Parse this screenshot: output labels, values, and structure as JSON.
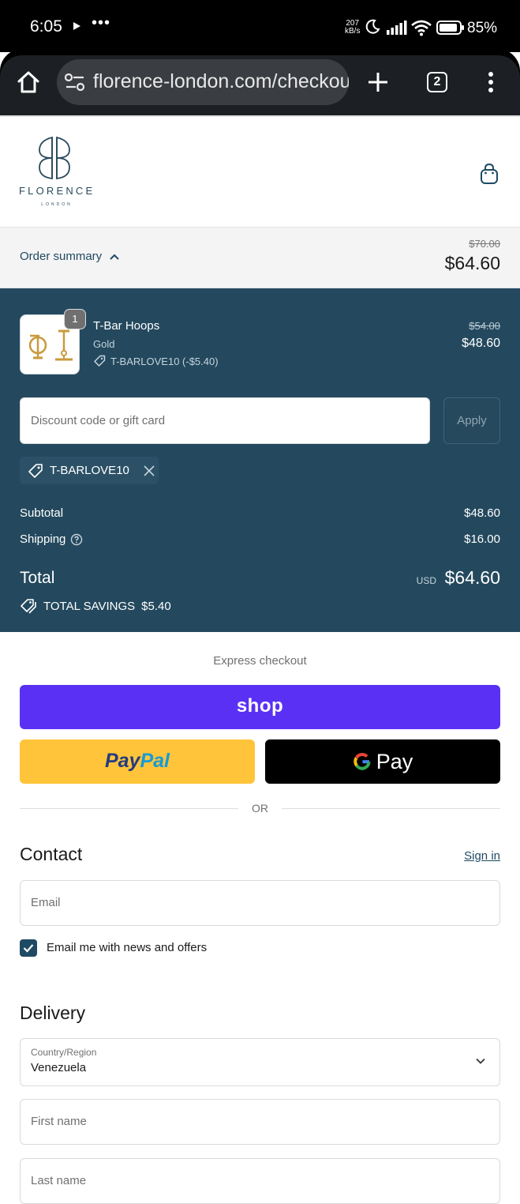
{
  "status_bar": {
    "time": "6:05",
    "overflow": "•••",
    "speed_value": "207",
    "speed_unit": "kB/s",
    "battery": "85%"
  },
  "browser": {
    "url": "florence-london.com/checkout",
    "tab_count": "2"
  },
  "brand": {
    "name": "FLORENCE",
    "sub": "LONDON"
  },
  "summary": {
    "toggle_label": "Order summary",
    "original_total": "$70.00",
    "total": "$64.60"
  },
  "product": {
    "quantity": "1",
    "name": "T-Bar Hoops",
    "variant": "Gold",
    "discount_line": "T-BARLOVE10 (-$5.40)",
    "original_price": "$54.00",
    "price": "$48.60"
  },
  "discount": {
    "placeholder": "Discount code or gift card",
    "apply_label": "Apply",
    "applied_code": "T-BARLOVE10"
  },
  "totals": {
    "subtotal_label": "Subtotal",
    "subtotal_value": "$48.60",
    "shipping_label": "Shipping",
    "shipping_value": "$16.00",
    "total_label": "Total",
    "currency": "USD",
    "total_value": "$64.60",
    "savings_label": "TOTAL SAVINGS",
    "savings_value": "$5.40"
  },
  "express": {
    "title": "Express checkout",
    "shop_label": "shop",
    "paypal_a": "Pay",
    "paypal_b": "Pal",
    "gpay_label": "Pay",
    "or_label": "OR"
  },
  "contact": {
    "heading": "Contact",
    "signin_label": "Sign in",
    "email_placeholder": "Email",
    "news_label": "Email me with news and offers",
    "news_checked": true
  },
  "delivery": {
    "heading": "Delivery",
    "country_label": "Country/Region",
    "country_value": "Venezuela",
    "first_name_placeholder": "First name",
    "last_name_placeholder": "Last name"
  },
  "colors": {
    "panel": "#24495e",
    "shop": "#5a31f4",
    "paypal": "#ffc439",
    "accent": "#1f4a63"
  }
}
